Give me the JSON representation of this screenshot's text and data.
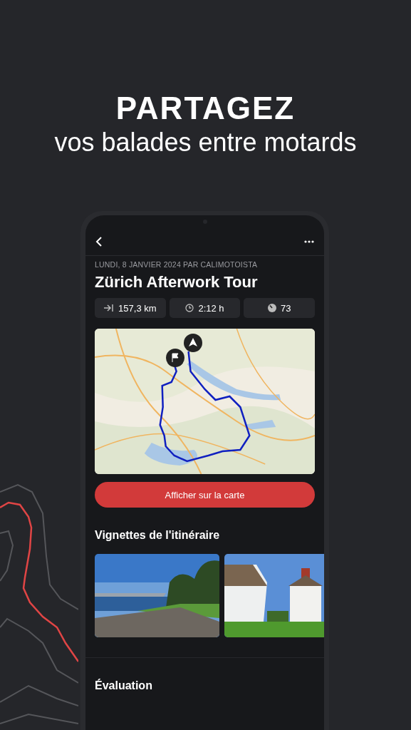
{
  "headline": {
    "title": "PARTAGEZ",
    "subtitle": "vos balades entre motards"
  },
  "phone": {
    "meta": "LUNDI, 8 JANVIER 2024 PAR CALIMOTOISTA",
    "title": "Zürich Afterwork Tour",
    "stats": [
      {
        "kind": "distance",
        "value": "157,3 km"
      },
      {
        "kind": "duration",
        "value": "2:12 h"
      },
      {
        "kind": "curves",
        "value": "73"
      }
    ],
    "map_button": "Afficher sur la carte",
    "gallery": {
      "title": "Vignettes de l'itinéraire",
      "photos": [
        {
          "kind": "lake"
        },
        {
          "kind": "church"
        }
      ]
    },
    "rating": {
      "title": "Évaluation"
    }
  }
}
